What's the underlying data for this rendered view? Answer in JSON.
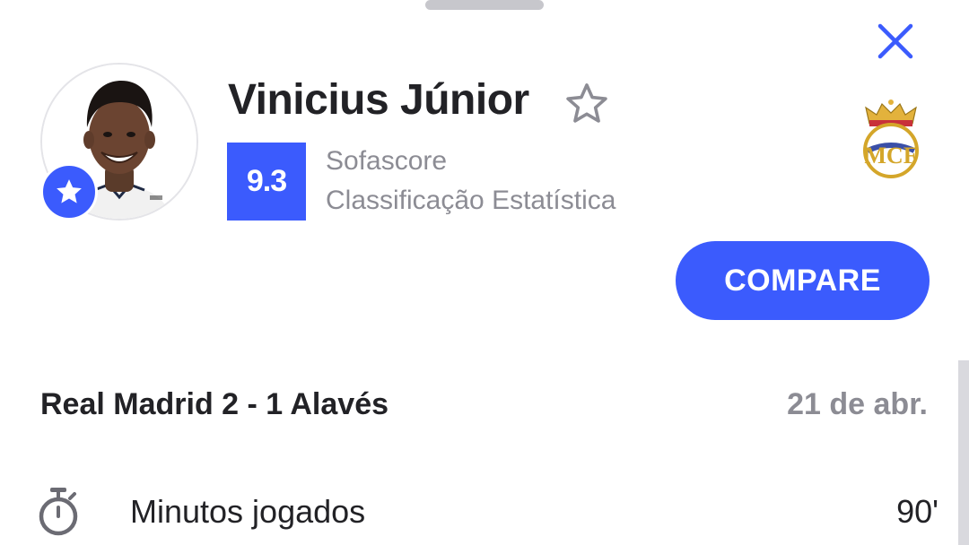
{
  "header": {
    "close_icon": "close-icon"
  },
  "player": {
    "name": "Vinicius Júnior",
    "avatar_badge_icon": "star-icon",
    "favorite_icon": "star-outline-icon",
    "team_logo": "real-madrid-crest"
  },
  "rating": {
    "value": "9.3",
    "source": "Sofascore",
    "description": "Classificação Estatística"
  },
  "actions": {
    "compare_label": "COMPARE"
  },
  "match": {
    "title": "Real Madrid 2 - 1 Alavés",
    "date": "21 de abr."
  },
  "stats": [
    {
      "icon": "stopwatch-icon",
      "label": "Minutos jogados",
      "value": "90'"
    }
  ],
  "colors": {
    "accent": "#3b5bfd",
    "text_primary": "#222226",
    "text_secondary": "#8c8c94"
  }
}
